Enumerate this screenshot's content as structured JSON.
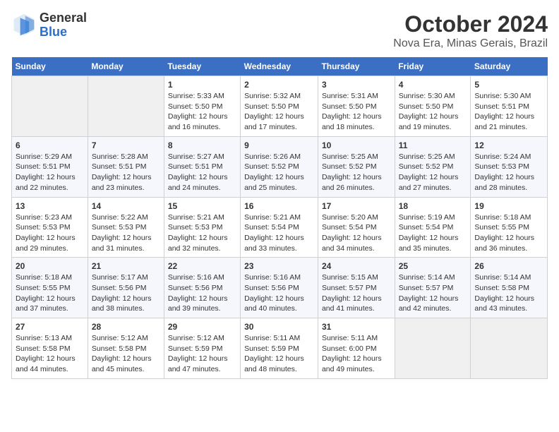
{
  "logo": {
    "line1": "General",
    "line2": "Blue"
  },
  "title": "October 2024",
  "subtitle": "Nova Era, Minas Gerais, Brazil",
  "days_header": [
    "Sunday",
    "Monday",
    "Tuesday",
    "Wednesday",
    "Thursday",
    "Friday",
    "Saturday"
  ],
  "weeks": [
    [
      {
        "day": "",
        "info": ""
      },
      {
        "day": "",
        "info": ""
      },
      {
        "day": "1",
        "info": "Sunrise: 5:33 AM\nSunset: 5:50 PM\nDaylight: 12 hours and 16 minutes."
      },
      {
        "day": "2",
        "info": "Sunrise: 5:32 AM\nSunset: 5:50 PM\nDaylight: 12 hours and 17 minutes."
      },
      {
        "day": "3",
        "info": "Sunrise: 5:31 AM\nSunset: 5:50 PM\nDaylight: 12 hours and 18 minutes."
      },
      {
        "day": "4",
        "info": "Sunrise: 5:30 AM\nSunset: 5:50 PM\nDaylight: 12 hours and 19 minutes."
      },
      {
        "day": "5",
        "info": "Sunrise: 5:30 AM\nSunset: 5:51 PM\nDaylight: 12 hours and 21 minutes."
      }
    ],
    [
      {
        "day": "6",
        "info": "Sunrise: 5:29 AM\nSunset: 5:51 PM\nDaylight: 12 hours and 22 minutes."
      },
      {
        "day": "7",
        "info": "Sunrise: 5:28 AM\nSunset: 5:51 PM\nDaylight: 12 hours and 23 minutes."
      },
      {
        "day": "8",
        "info": "Sunrise: 5:27 AM\nSunset: 5:51 PM\nDaylight: 12 hours and 24 minutes."
      },
      {
        "day": "9",
        "info": "Sunrise: 5:26 AM\nSunset: 5:52 PM\nDaylight: 12 hours and 25 minutes."
      },
      {
        "day": "10",
        "info": "Sunrise: 5:25 AM\nSunset: 5:52 PM\nDaylight: 12 hours and 26 minutes."
      },
      {
        "day": "11",
        "info": "Sunrise: 5:25 AM\nSunset: 5:52 PM\nDaylight: 12 hours and 27 minutes."
      },
      {
        "day": "12",
        "info": "Sunrise: 5:24 AM\nSunset: 5:53 PM\nDaylight: 12 hours and 28 minutes."
      }
    ],
    [
      {
        "day": "13",
        "info": "Sunrise: 5:23 AM\nSunset: 5:53 PM\nDaylight: 12 hours and 29 minutes."
      },
      {
        "day": "14",
        "info": "Sunrise: 5:22 AM\nSunset: 5:53 PM\nDaylight: 12 hours and 31 minutes."
      },
      {
        "day": "15",
        "info": "Sunrise: 5:21 AM\nSunset: 5:53 PM\nDaylight: 12 hours and 32 minutes."
      },
      {
        "day": "16",
        "info": "Sunrise: 5:21 AM\nSunset: 5:54 PM\nDaylight: 12 hours and 33 minutes."
      },
      {
        "day": "17",
        "info": "Sunrise: 5:20 AM\nSunset: 5:54 PM\nDaylight: 12 hours and 34 minutes."
      },
      {
        "day": "18",
        "info": "Sunrise: 5:19 AM\nSunset: 5:54 PM\nDaylight: 12 hours and 35 minutes."
      },
      {
        "day": "19",
        "info": "Sunrise: 5:18 AM\nSunset: 5:55 PM\nDaylight: 12 hours and 36 minutes."
      }
    ],
    [
      {
        "day": "20",
        "info": "Sunrise: 5:18 AM\nSunset: 5:55 PM\nDaylight: 12 hours and 37 minutes."
      },
      {
        "day": "21",
        "info": "Sunrise: 5:17 AM\nSunset: 5:56 PM\nDaylight: 12 hours and 38 minutes."
      },
      {
        "day": "22",
        "info": "Sunrise: 5:16 AM\nSunset: 5:56 PM\nDaylight: 12 hours and 39 minutes."
      },
      {
        "day": "23",
        "info": "Sunrise: 5:16 AM\nSunset: 5:56 PM\nDaylight: 12 hours and 40 minutes."
      },
      {
        "day": "24",
        "info": "Sunrise: 5:15 AM\nSunset: 5:57 PM\nDaylight: 12 hours and 41 minutes."
      },
      {
        "day": "25",
        "info": "Sunrise: 5:14 AM\nSunset: 5:57 PM\nDaylight: 12 hours and 42 minutes."
      },
      {
        "day": "26",
        "info": "Sunrise: 5:14 AM\nSunset: 5:58 PM\nDaylight: 12 hours and 43 minutes."
      }
    ],
    [
      {
        "day": "27",
        "info": "Sunrise: 5:13 AM\nSunset: 5:58 PM\nDaylight: 12 hours and 44 minutes."
      },
      {
        "day": "28",
        "info": "Sunrise: 5:12 AM\nSunset: 5:58 PM\nDaylight: 12 hours and 45 minutes."
      },
      {
        "day": "29",
        "info": "Sunrise: 5:12 AM\nSunset: 5:59 PM\nDaylight: 12 hours and 47 minutes."
      },
      {
        "day": "30",
        "info": "Sunrise: 5:11 AM\nSunset: 5:59 PM\nDaylight: 12 hours and 48 minutes."
      },
      {
        "day": "31",
        "info": "Sunrise: 5:11 AM\nSunset: 6:00 PM\nDaylight: 12 hours and 49 minutes."
      },
      {
        "day": "",
        "info": ""
      },
      {
        "day": "",
        "info": ""
      }
    ]
  ]
}
